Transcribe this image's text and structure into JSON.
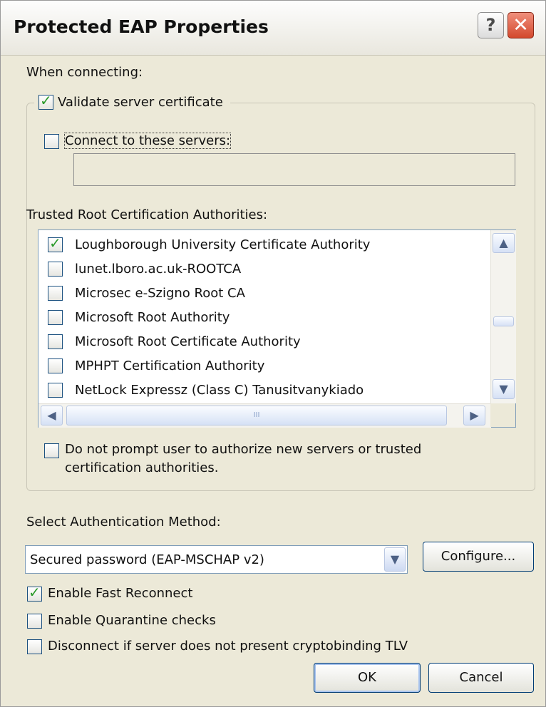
{
  "window": {
    "title": "Protected EAP Properties",
    "help_label": "?",
    "close_label": "✕"
  },
  "when_connecting_label": "When connecting:",
  "validate_server_certificate": {
    "label": "Validate server certificate",
    "checked": true
  },
  "connect_to_servers": {
    "label": "Connect to these servers:",
    "checked": false,
    "value": ""
  },
  "trusted_root_label": "Trusted Root Certification Authorities:",
  "certificate_authorities": [
    {
      "label": "Loughborough University Certificate Authority",
      "checked": true
    },
    {
      "label": "lunet.lboro.ac.uk-ROOTCA",
      "checked": false
    },
    {
      "label": "Microsec e-Szigno Root CA",
      "checked": false
    },
    {
      "label": "Microsoft Root Authority",
      "checked": false
    },
    {
      "label": "Microsoft Root Certificate Authority",
      "checked": false
    },
    {
      "label": "MPHPT Certification Authority",
      "checked": false
    },
    {
      "label": "NetLock Expressz (Class C) Tanusitvanykiado",
      "checked": false
    }
  ],
  "scrollbar": {
    "up": "▲",
    "down": "▼",
    "left": "◀",
    "right": "▶",
    "grip": "III",
    "vertical_position": 0.55
  },
  "do_not_prompt": {
    "line1": "Do not prompt user to authorize new servers or trusted",
    "line2": "certification authorities.",
    "checked": false
  },
  "select_auth_method_label": "Select Authentication Method:",
  "auth_method": {
    "value": "Secured password (EAP-MSCHAP v2)",
    "arrow": "▼"
  },
  "configure_label": "Configure...",
  "enable_fast_reconnect": {
    "label": "Enable Fast Reconnect",
    "checked": true
  },
  "enable_quarantine_checks": {
    "label": "Enable Quarantine checks",
    "checked": false
  },
  "disconnect_cryptobinding": {
    "label": "Disconnect if server does not present cryptobinding TLV",
    "checked": false
  },
  "ok_label": "OK",
  "cancel_label": "Cancel"
}
